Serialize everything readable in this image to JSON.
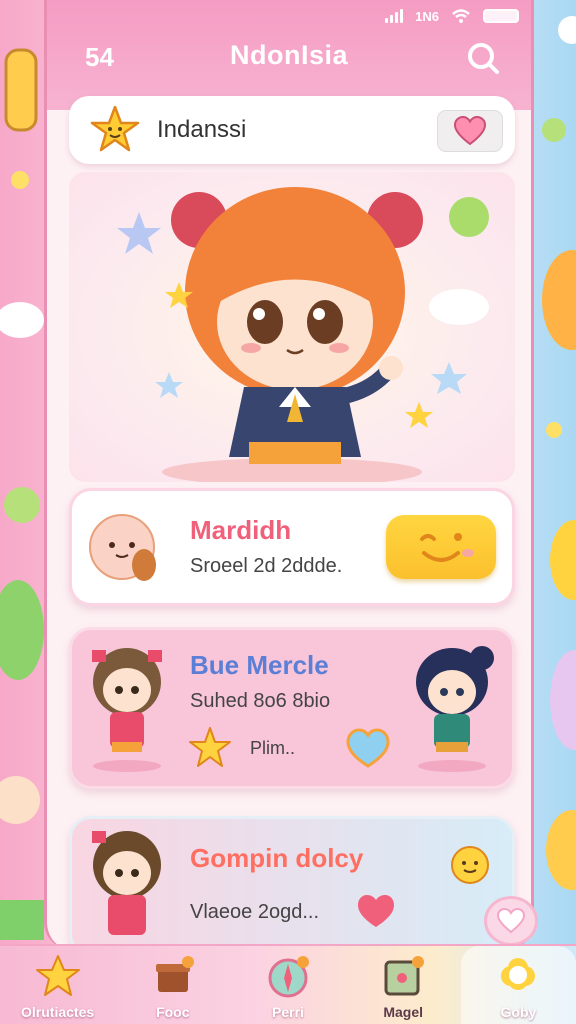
{
  "status_bar": {
    "carrier": "1N6",
    "battery": "full"
  },
  "header": {
    "time": "54",
    "title": "NdonIsia",
    "search_icon": "search-icon"
  },
  "search_card": {
    "label": "Indanssi",
    "star_icon": "star-face-icon",
    "heart_icon": "heart-icon"
  },
  "cards": [
    {
      "title": "Mardidh",
      "subtitle": "Sroeel 2d 2ddde.",
      "title_color": "#f0607a",
      "button_icon": "smiley-face-icon"
    },
    {
      "title": "Bue Mercle",
      "subtitle": "Suhed 8o6 8bio",
      "note": "Plim..",
      "title_color": "#5b7fd6"
    },
    {
      "title": "Gompin dolcy",
      "subtitle": "Vlaeoe 2ogd...",
      "title_color": "#ff6f61"
    }
  ],
  "fab": {
    "icon": "heart-icon"
  },
  "tabs": [
    {
      "label": "Olrutiactes",
      "icon": "star-icon",
      "active": false
    },
    {
      "label": "Fooc",
      "icon": "gift-box-icon",
      "active": false
    },
    {
      "label": "Perri",
      "icon": "compass-icon",
      "active": false
    },
    {
      "label": "Magel",
      "icon": "map-icon",
      "active": false
    },
    {
      "label": "Goby",
      "icon": "cloud-flower-icon",
      "active": true
    }
  ],
  "colors": {
    "primary_pink": "#f59cc3",
    "accent_yellow": "#fbc02d",
    "heart_red": "#f0607a"
  }
}
